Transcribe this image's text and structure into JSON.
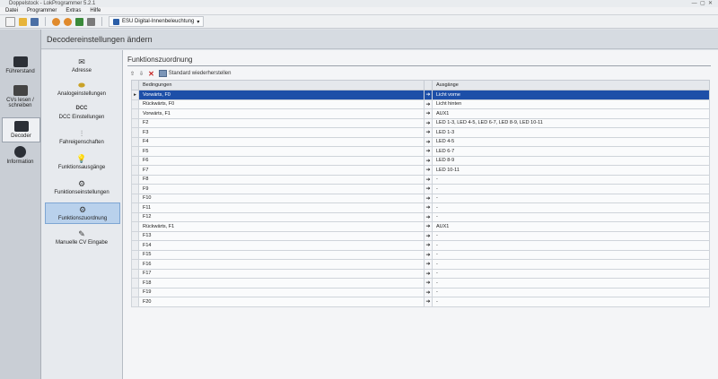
{
  "window": {
    "title": "Doppelstock - LokProgrammer 5.2.1"
  },
  "menu": {
    "items": [
      "Datei",
      "Programmer",
      "Extras",
      "Hilfe"
    ]
  },
  "toolbar": {
    "profile_label": "ESU Digital-Innenbeleuchtung"
  },
  "leftnav": {
    "items": [
      {
        "label": "Führerstand"
      },
      {
        "label": "CVs lesen / schreiben"
      },
      {
        "label": "Decoder"
      },
      {
        "label": "Information"
      }
    ]
  },
  "header": {
    "title": "Decodereinstellungen ändern"
  },
  "categories": [
    {
      "label": "Adresse",
      "glyph": "✉"
    },
    {
      "label": "Analogeinstellungen",
      "glyph": "⬬"
    },
    {
      "label": "DCC Einstellungen",
      "glyph": "DCC"
    },
    {
      "label": "Fahreigenschaften",
      "glyph": "⫶"
    },
    {
      "label": "Funktionsausgänge",
      "glyph": "💡"
    },
    {
      "label": "Funktionseinstellungen",
      "glyph": "⚙"
    },
    {
      "label": "Funktionszuordnung",
      "glyph": "⚙"
    },
    {
      "label": "Manuelle CV Eingabe",
      "glyph": "✎"
    }
  ],
  "section": {
    "title": "Funktionszuordnung"
  },
  "grid_toolbar": {
    "standard_label": "Standard wiederherstellen"
  },
  "grid": {
    "headers": [
      "Bedingungen",
      "Ausgänge"
    ],
    "selected_index": 0,
    "rows": [
      {
        "condition": "Vorwärts, F0",
        "output": "Licht vorne"
      },
      {
        "condition": "Rückwärts, F0",
        "output": "Licht hinten"
      },
      {
        "condition": "Vorwärts, F1",
        "output": "AUX1"
      },
      {
        "condition": "F2",
        "output": "LED 1-3, LED 4-5, LED 6-7, LED 8-9, LED 10-11"
      },
      {
        "condition": "F3",
        "output": "LED 1-3"
      },
      {
        "condition": "F4",
        "output": "LED 4-5"
      },
      {
        "condition": "F5",
        "output": "LED 6-7"
      },
      {
        "condition": "F6",
        "output": "LED 8-9"
      },
      {
        "condition": "F7",
        "output": "LED 10-11"
      },
      {
        "condition": "F8",
        "output": "-"
      },
      {
        "condition": "F9",
        "output": "-"
      },
      {
        "condition": "F10",
        "output": "-"
      },
      {
        "condition": "F11",
        "output": "-"
      },
      {
        "condition": "F12",
        "output": "-"
      },
      {
        "condition": "Rückwärts, F1",
        "output": "AUX1"
      },
      {
        "condition": "F13",
        "output": "-"
      },
      {
        "condition": "F14",
        "output": "-"
      },
      {
        "condition": "F15",
        "output": "-"
      },
      {
        "condition": "F16",
        "output": "-"
      },
      {
        "condition": "F17",
        "output": "-"
      },
      {
        "condition": "F18",
        "output": "-"
      },
      {
        "condition": "F19",
        "output": "-"
      },
      {
        "condition": "F20",
        "output": "-"
      }
    ]
  },
  "colors": {
    "selection": "#1d4fa8",
    "active_category": "#b9d1ec"
  }
}
